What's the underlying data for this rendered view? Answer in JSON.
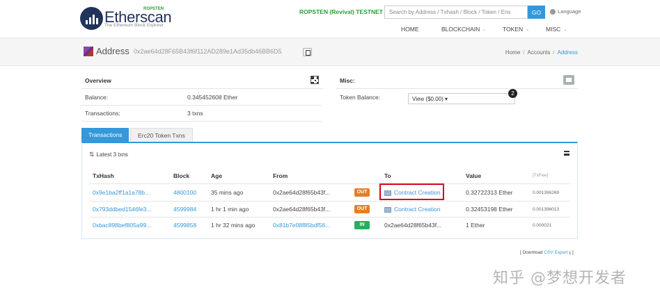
{
  "header": {
    "logo_text": "Etherscan",
    "logo_network_tag": "ROPSTEN",
    "logo_tagline": "The Ethereum Block Explorer",
    "network_label": "ROPSTEN (Revival) TESTNET",
    "search_placeholder": "Search by Address / Txhash / Block / Token / Ens",
    "search_button": "GO",
    "language": "Language",
    "nav": [
      "HOME",
      "BLOCKCHAIN",
      "TOKEN",
      "MISC"
    ]
  },
  "address_bar": {
    "title": "Address",
    "hash": "0x2ae64d28F65B43f6f112AD289e1Ad35db46BB6D5",
    "breadcrumb": [
      "Home",
      "Accounts",
      "Address"
    ]
  },
  "overview": {
    "title": "Overview",
    "balance_label": "Balance:",
    "balance_value": "0.345452608 Ether",
    "transactions_label": "Transactions:",
    "transactions_value": "3 txns"
  },
  "misc": {
    "title": "Misc:",
    "token_balance_label": "Token Balance:",
    "token_balance_value": "View ($0.00)",
    "token_count": "2"
  },
  "tabs": [
    "Transactions",
    "Erc20 Token Txns"
  ],
  "txn_panel": {
    "latest_label": "Latest 3 txns",
    "columns": [
      "TxHash",
      "Block",
      "Age",
      "From",
      "To",
      "Value",
      "[TxFee]"
    ],
    "rows": [
      {
        "hash": "0x9e1ba2ff1a1a78b...",
        "block": "4800100",
        "age": "35 mins ago",
        "from": "0x2ae64d28f65b43f...",
        "dir": "OUT",
        "to": "Contract Creation",
        "value": "0.32722313 Ether",
        "fee": "0.001396269"
      },
      {
        "hash": "0x793ddbed1546fe3...",
        "block": "4599984",
        "age": "1 hr 1 min ago",
        "from": "0x2ae64d28f65b43f...",
        "dir": "OUT",
        "to": "Contract Creation",
        "value": "0.32453198 Ether",
        "fee": "0.001396013"
      },
      {
        "hash": "0xbac898bef805a99...",
        "block": "4599858",
        "age": "1 hr 32 mins ago",
        "from": "0x81b7e08f85bdf56...",
        "dir": "IN",
        "to": "0x2ae64d28f65b43f...",
        "value": "1 Ether",
        "fee": "0.000021"
      }
    ]
  },
  "csv": {
    "prefix": "[ Download",
    "link": "CSV Export",
    "suffix": "]"
  },
  "watermark": "知乎 @梦想开发者",
  "colors": {
    "accent": "#3498db",
    "out": "#e67e22",
    "in": "#27ae60",
    "testnet": "#2a9d3a",
    "highlight": "#d0021b"
  }
}
